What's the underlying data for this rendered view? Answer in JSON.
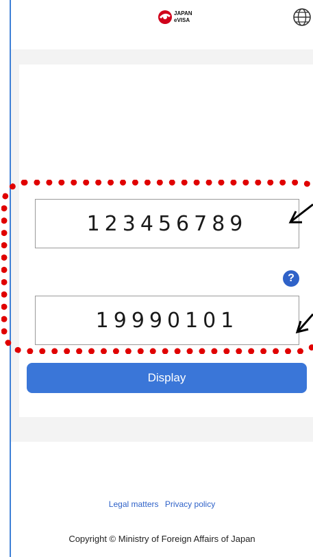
{
  "header": {
    "logo_line1": "JAPAN",
    "logo_line2": "eVISA"
  },
  "form": {
    "field1_value": "123456789",
    "field2_value": "19990101",
    "help_label": "?",
    "display_label": "Display"
  },
  "footer": {
    "legal": "Legal matters",
    "privacy": "Privacy policy",
    "copyright": "Copyright © Ministry of Foreign Affairs of Japan"
  },
  "colors": {
    "accent": "#3a76d8",
    "highlight": "#e00000",
    "logo": "#d0021b"
  },
  "icons": {
    "globe": "globe-icon",
    "help": "help-icon",
    "logo": "japan-evisa-logo"
  }
}
